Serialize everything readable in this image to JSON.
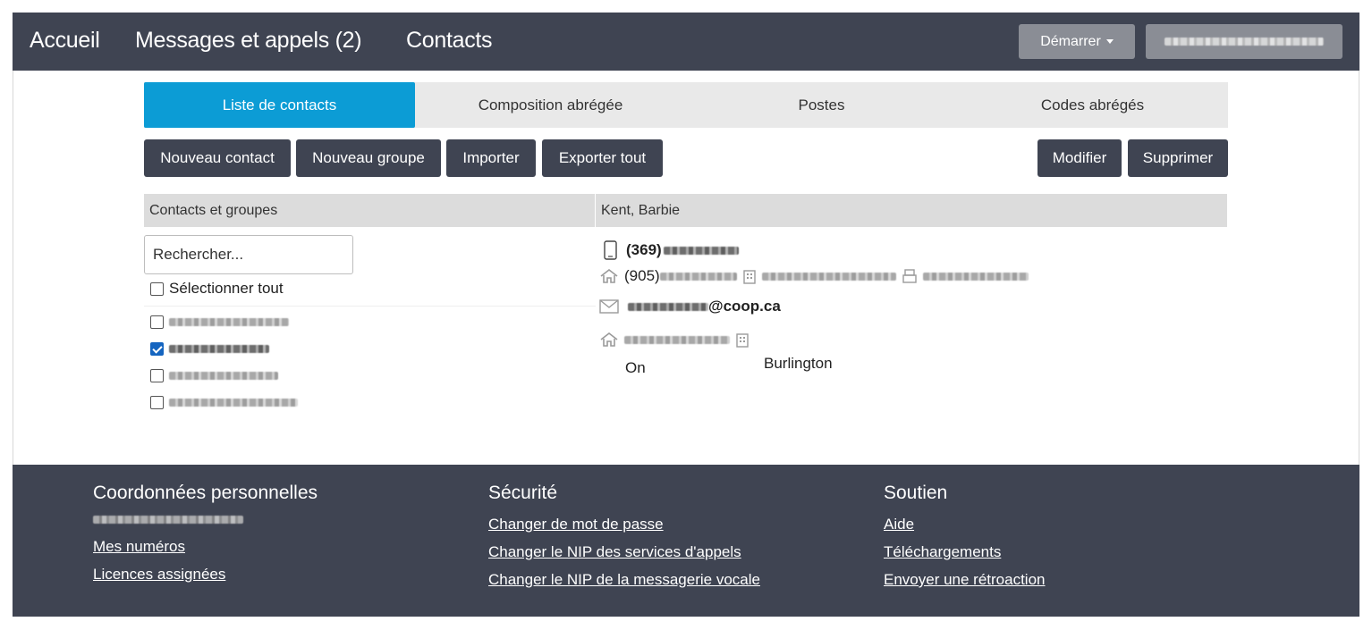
{
  "nav": {
    "accueil": "Accueil",
    "messages": "Messages et appels (2)",
    "contacts": "Contacts",
    "demarrer": "Démarrer"
  },
  "tabs": [
    {
      "label": "Liste de contacts",
      "active": true
    },
    {
      "label": "Composition abrégée",
      "active": false
    },
    {
      "label": "Postes",
      "active": false
    },
    {
      "label": "Codes abrégés",
      "active": false
    }
  ],
  "toolbar": {
    "nouveau_contact": "Nouveau contact",
    "nouveau_groupe": "Nouveau groupe",
    "importer": "Importer",
    "exporter_tout": "Exporter tout",
    "modifier": "Modifier",
    "supprimer": "Supprimer"
  },
  "left_panel": {
    "header": "Contacts et groupes",
    "search_placeholder": "Rechercher...",
    "select_all": "Sélectionner tout",
    "contacts": [
      {
        "checked": false
      },
      {
        "checked": true
      },
      {
        "checked": false
      },
      {
        "checked": false
      }
    ]
  },
  "detail": {
    "header": "Kent, Barbie",
    "mobile_prefix": "(369)",
    "home_prefix": "(905)",
    "email_domain": "@coop.ca",
    "province": "On",
    "city": "Burlington"
  },
  "footer": {
    "personal": {
      "title": "Coordonnées personnelles",
      "links": [
        "Mes numéros",
        "Licences assignées"
      ]
    },
    "security": {
      "title": "Sécurité",
      "links": [
        "Changer de mot de passe",
        "Changer le NIP des services d'appels",
        "Changer le NIP de la messagerie vocale"
      ]
    },
    "support": {
      "title": "Soutien",
      "links": [
        "Aide",
        "Téléchargements",
        "Envoyer une rétroaction"
      ]
    }
  },
  "colors": {
    "nav_bg": "#3f4452",
    "tab_active": "#0c9cd5",
    "button_dark": "#3f4452",
    "panel_header": "#dcdcdc"
  }
}
